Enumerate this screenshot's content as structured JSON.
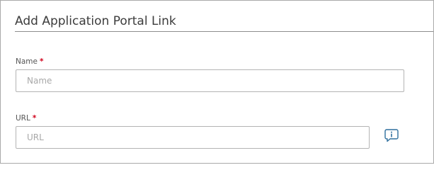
{
  "dialog": {
    "title": "Add Application Portal Link"
  },
  "form": {
    "name": {
      "label": "Name",
      "required_mark": "*",
      "value": "",
      "placeholder": "Name"
    },
    "url": {
      "label": "URL",
      "required_mark": "*",
      "value": "",
      "placeholder": "URL",
      "help_icon": "info-speech-bubble-icon"
    }
  },
  "colors": {
    "required": "#d0021b",
    "icon": "#2e6f9e",
    "border": "#b4b4b4",
    "title_text": "#3c3c3c"
  }
}
